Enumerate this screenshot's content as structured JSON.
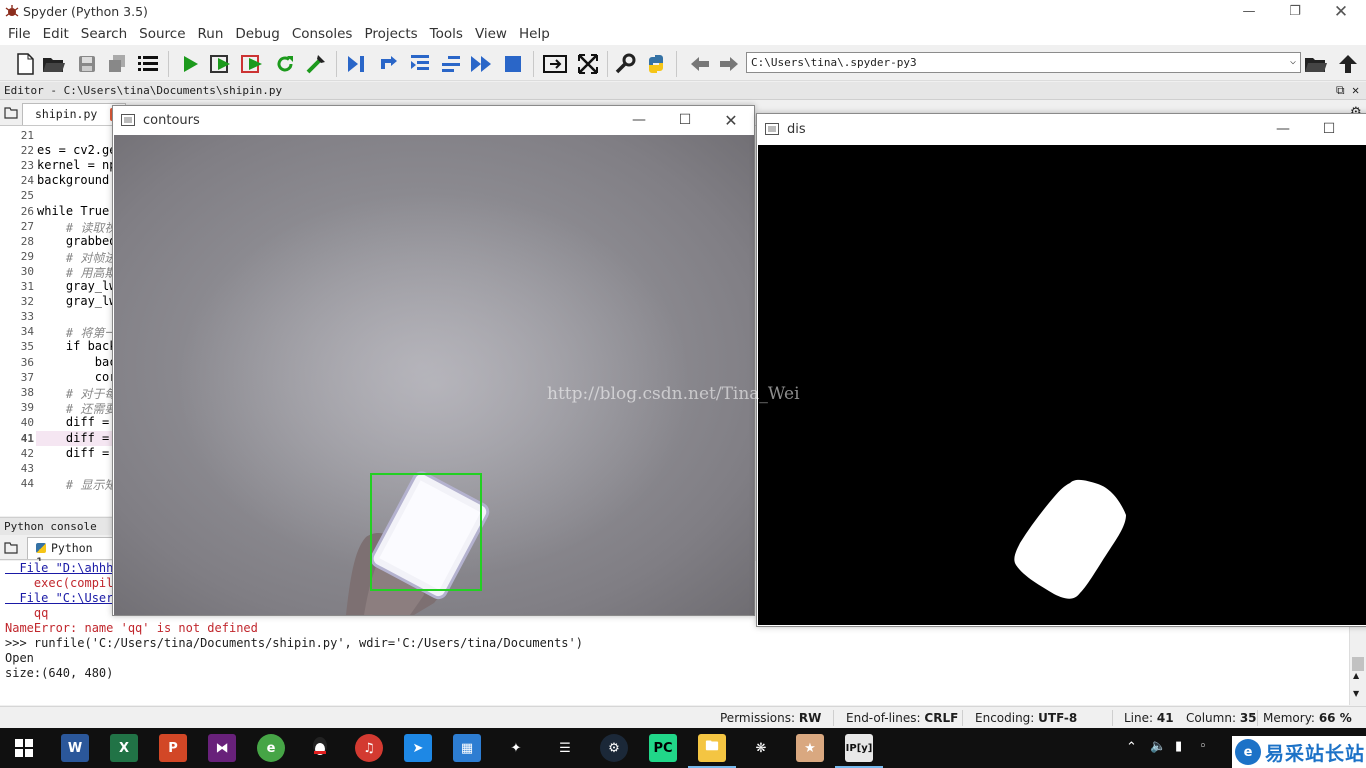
{
  "window": {
    "title": "Spyder (Python 3.5)"
  },
  "menu": [
    "File",
    "Edit",
    "Search",
    "Source",
    "Run",
    "Debug",
    "Consoles",
    "Projects",
    "Tools",
    "View",
    "Help"
  ],
  "toolbar": {
    "working_dir": "C:\\Users\\tina\\.spyder-py3"
  },
  "editor": {
    "pane_title": "Editor - C:\\Users\\tina\\Documents\\shipin.py",
    "tab": "shipin.py",
    "current_line": 41,
    "lines": [
      {
        "n": "21",
        "t": ""
      },
      {
        "n": "22",
        "t": "es = cv2.ge"
      },
      {
        "n": "23",
        "t": "kernel = np"
      },
      {
        "n": "24",
        "t": "background"
      },
      {
        "n": "25",
        "t": ""
      },
      {
        "n": "26",
        "t": "while True:"
      },
      {
        "n": "27",
        "t": "    # 读取视"
      },
      {
        "n": "28",
        "t": "    grabbed"
      },
      {
        "n": "29",
        "t": "    # 对帧进"
      },
      {
        "n": "30",
        "t": "    # 用高斯"
      },
      {
        "n": "31",
        "t": "    gray_lw"
      },
      {
        "n": "32",
        "t": "    gray_lw"
      },
      {
        "n": "33",
        "t": ""
      },
      {
        "n": "34",
        "t": "    # 将第一"
      },
      {
        "n": "35",
        "t": "    if back"
      },
      {
        "n": "36",
        "t": "        bac"
      },
      {
        "n": "37",
        "t": "        cor"
      },
      {
        "n": "38",
        "t": "    # 对于每"
      },
      {
        "n": "39",
        "t": "    # 还需要"
      },
      {
        "n": "40",
        "t": "    diff ="
      },
      {
        "n": "41",
        "t": "    diff ="
      },
      {
        "n": "42",
        "t": "    diff ="
      },
      {
        "n": "43",
        "t": ""
      },
      {
        "n": "44",
        "t": "    # 显示矩"
      }
    ]
  },
  "console": {
    "pane_title": "Python console",
    "tab": "Python 1",
    "lines": [
      {
        "t": "  File \"D:\\ahhhh",
        "style": "blue"
      },
      {
        "t": "    exec(compile",
        "style": "red"
      },
      {
        "t": "  File \"C:\\Users",
        "style": "blue"
      },
      {
        "t": "    qq",
        "style": "red"
      },
      {
        "t": "NameError: name 'qq' is not defined",
        "style": "red"
      },
      {
        "t": ">>> runfile('C:/Users/tina/Documents/shipin.py', wdir='C:/Users/tina/Documents')",
        "style": "plain"
      },
      {
        "t": "Open",
        "style": "plain"
      },
      {
        "t": "size:(640, 480)",
        "style": "plain"
      }
    ]
  },
  "cv_windows": {
    "contours": {
      "title": "contours"
    },
    "dis": {
      "title": "dis"
    }
  },
  "watermark": "http://blog.csdn.net/Tina_Wei",
  "statusbar": {
    "permissions_label": "Permissions:",
    "permissions": "RW",
    "eol_label": "End-of-lines:",
    "eol": "CRLF",
    "encoding_label": "Encoding:",
    "encoding": "UTF-8",
    "line_label": "Line:",
    "line": "41",
    "column_label": "Column:",
    "column": "35",
    "memory_label": "Memory:",
    "memory": "66 %"
  },
  "taskbar": {
    "brand": "易采站长站",
    "apps": [
      "start",
      "word",
      "excel",
      "powerpoint",
      "visual-studio",
      "browser",
      "qq",
      "netease-music",
      "feishu-arrow",
      "app-grid",
      "network-app",
      "cloud-app",
      "steam",
      "pycharm",
      "file-explorer",
      "gear-app",
      "photo-app",
      "ipython"
    ]
  },
  "colors": {
    "accent": "#76b9ed",
    "bbox": "#22d022"
  }
}
